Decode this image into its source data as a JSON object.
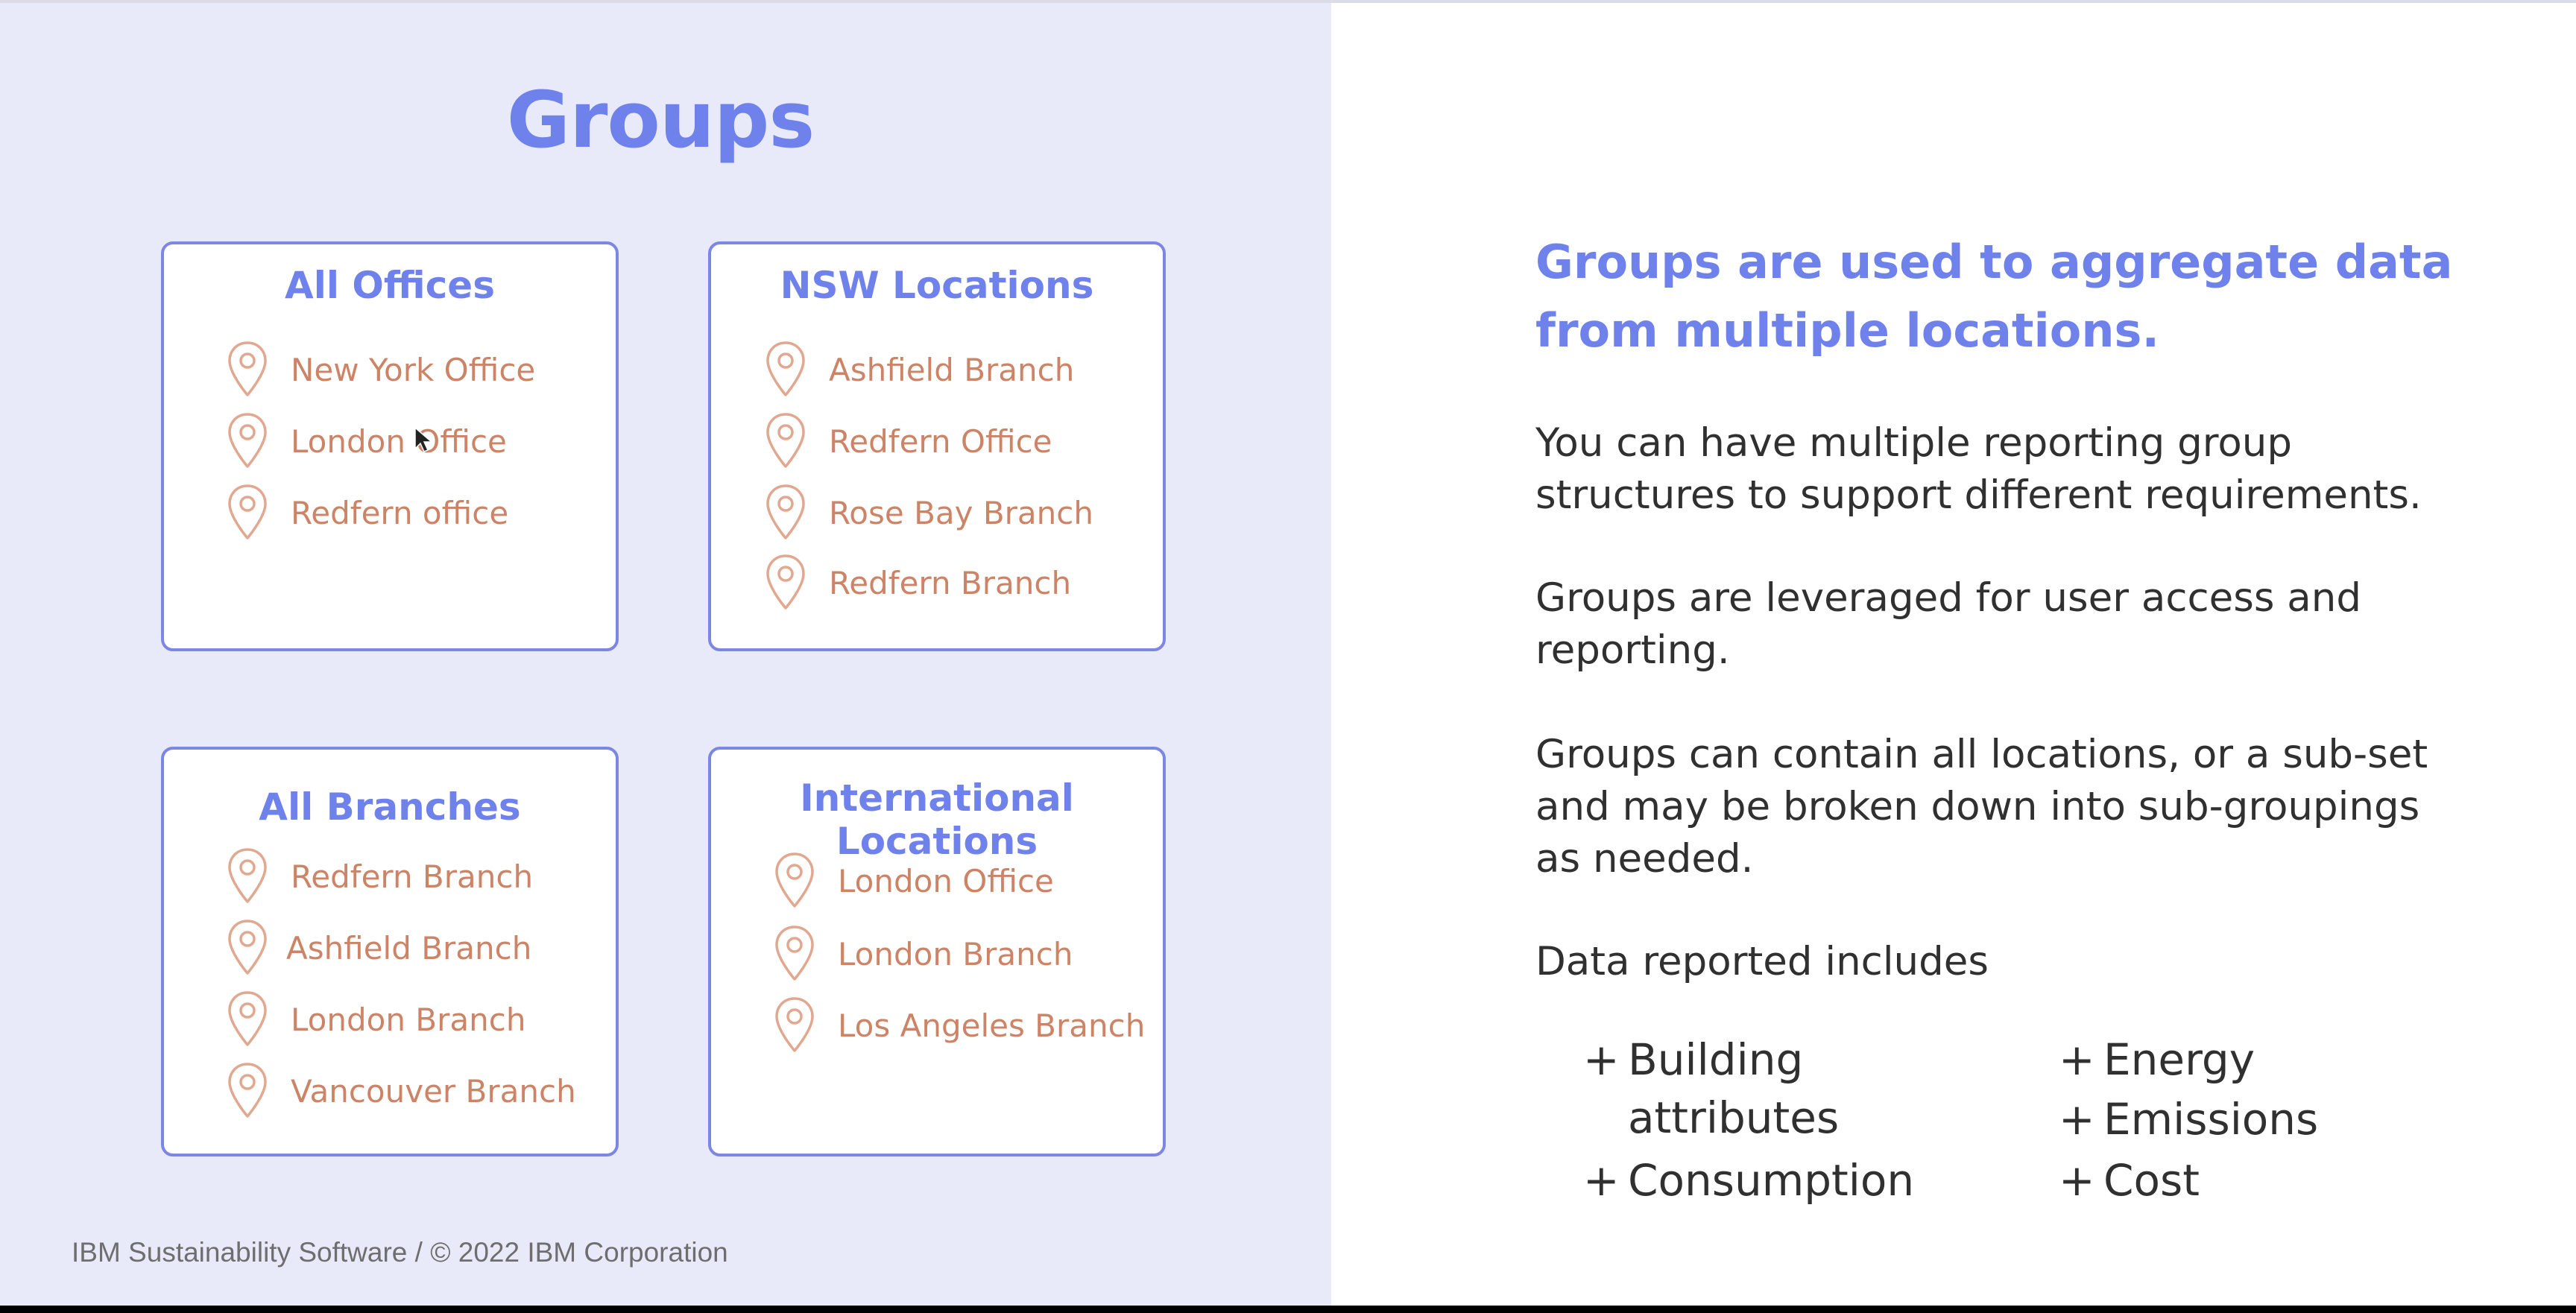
{
  "title": "Groups",
  "groups": [
    {
      "title": "All Offices",
      "locations": [
        "New York Office",
        "London Office",
        "Redfern office"
      ]
    },
    {
      "title": "NSW Locations",
      "locations": [
        "Ashfield Branch",
        "Redfern Office",
        "Rose Bay Branch",
        "Redfern Branch"
      ]
    },
    {
      "title": "All Branches",
      "locations": [
        "Redfern Branch",
        "Ashfield Branch",
        "London Branch",
        "Vancouver Branch"
      ]
    },
    {
      "title": "International Locations",
      "locations": [
        "London Office",
        "London Branch",
        "Los Angeles Branch"
      ]
    }
  ],
  "headline": "Groups are used to aggregate data from multiple locations.",
  "paragraphs": [
    "You can have multiple reporting group structures to support different requirements.",
    "Groups are leveraged for user access and reporting.",
    "Groups can contain all locations, or a sub-set and may be broken down into sub-groupings as needed.",
    "Data reported includes"
  ],
  "data_items": {
    "left": [
      "Building",
      "attributes",
      "Consumption"
    ],
    "right": [
      "Energy",
      "Emissions",
      "Cost"
    ],
    "bullet": "+"
  },
  "footer": "IBM Sustainability Software / © 2022 IBM Corporation",
  "icons": {
    "location": "location-pin-icon",
    "cursor": "mouse-cursor-icon"
  },
  "colors": {
    "accent": "#6f82ec",
    "location_text": "#cd8466",
    "pin_stroke": "#e2a88f",
    "card_border": "#7b87e3",
    "left_background": "#e8eafa"
  }
}
